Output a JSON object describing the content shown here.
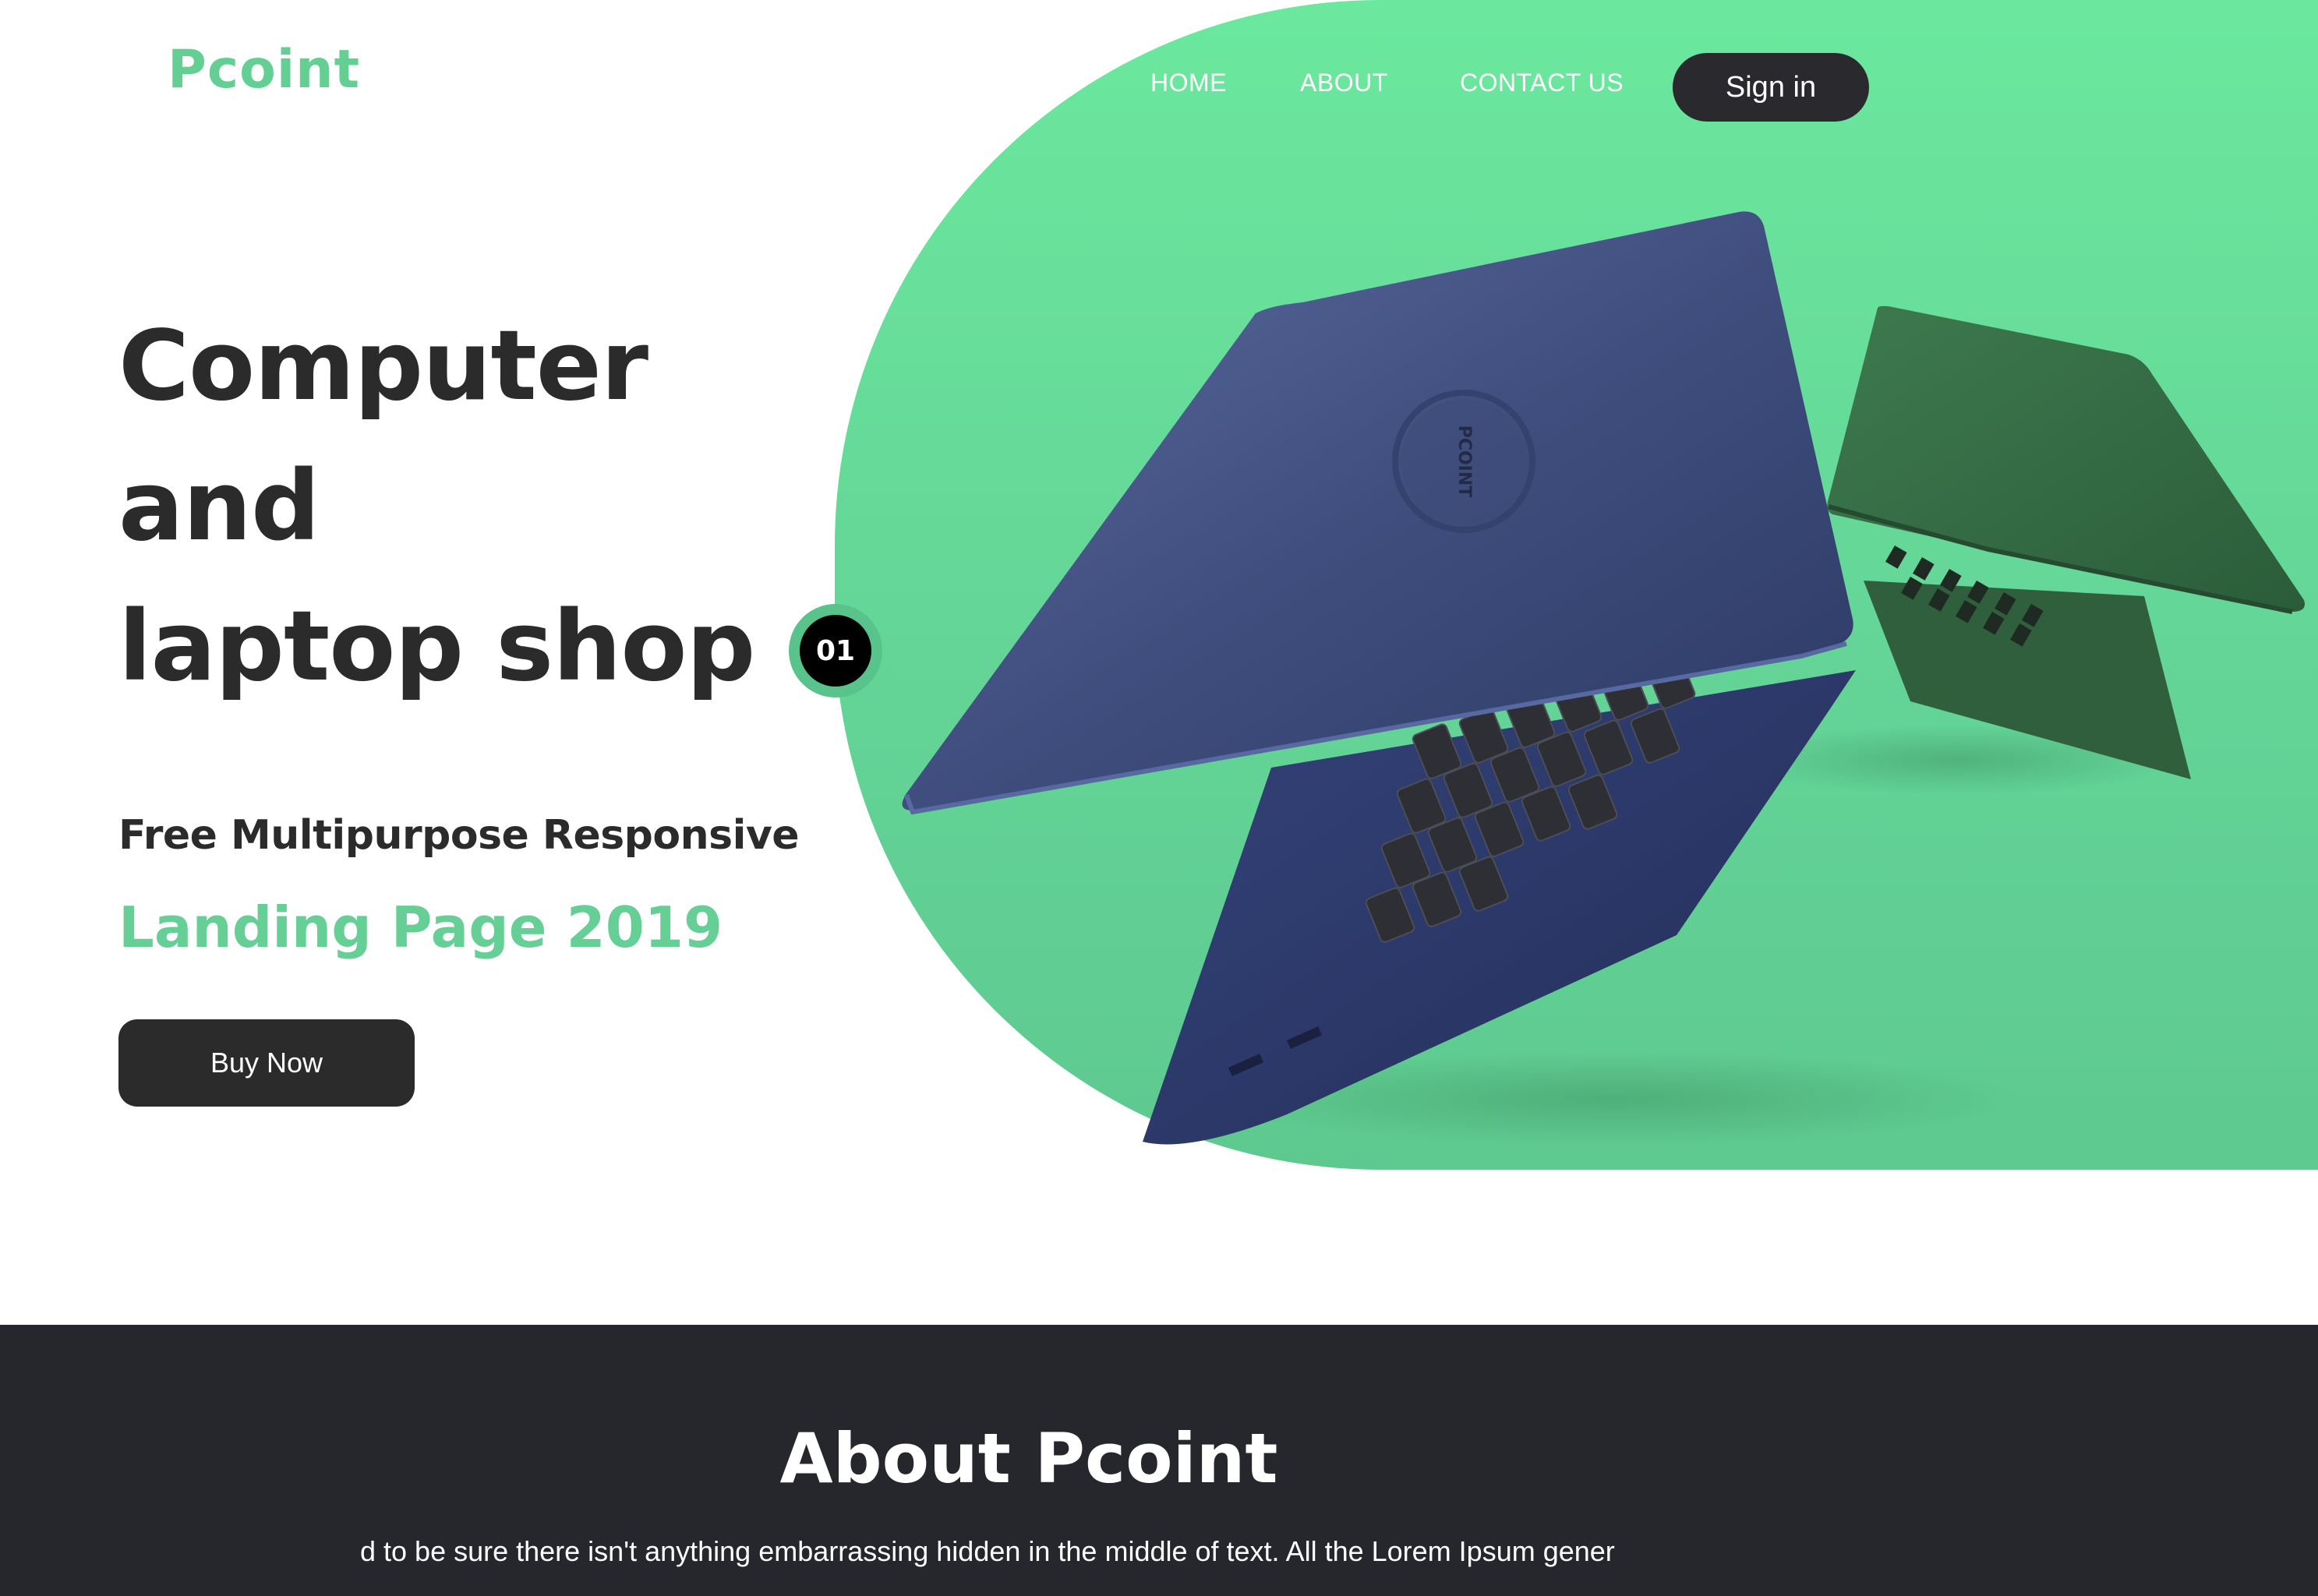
{
  "header": {
    "logo": "Pcoint",
    "nav": [
      "HOME",
      "ABOUT",
      "CONTACT US"
    ],
    "signin_label": "Sign in"
  },
  "hero": {
    "title_lines": [
      "Computer",
      "and",
      "laptop shop"
    ],
    "subtitle": "Free Multipurpose Responsive",
    "subtitle_accent": "Landing Page 2019",
    "buy_label": "Buy Now",
    "slide_number": "01",
    "laptop_brand": "PCOINT"
  },
  "about": {
    "title": "About Pcoint",
    "text": "d to be sure there isn't anything embarrassing hidden in the middle of text. All the Lorem Ipsum gener"
  },
  "colors": {
    "accent": "#63cf93",
    "blob": "#6be89e",
    "dark": "#2b2b2b",
    "about_bg": "#26272c"
  }
}
